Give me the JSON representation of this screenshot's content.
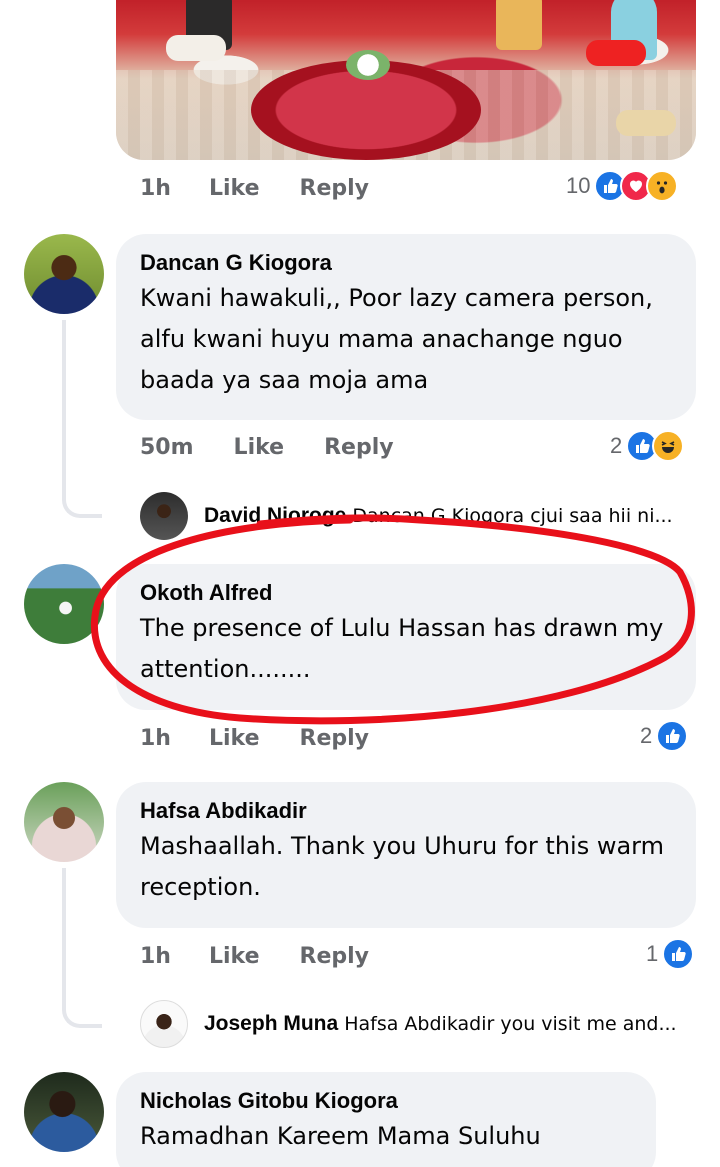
{
  "post_image": {
    "description_icon": "photo-icon"
  },
  "post_actions": {
    "time": "1h",
    "like": "Like",
    "reply": "Reply",
    "reaction_count": "10"
  },
  "comments": [
    {
      "author": "Dancan G Kiogora",
      "text": "Kwani hawakuli,, Poor lazy camera person, alfu kwani huyu mama anachange nguo baada ya saa moja ama",
      "time": "50m",
      "like": "Like",
      "reply": "Reply",
      "reaction_count": "2",
      "reply_preview": {
        "author": "David Njoroge",
        "text": "Dancan G Kiogora cjui saa hii ni..."
      }
    },
    {
      "author": "Okoth Alfred",
      "text": "The presence of Lulu Hassan has drawn my attention........",
      "time": "1h",
      "like": "Like",
      "reply": "Reply",
      "reaction_count": "2"
    },
    {
      "author": "Hafsa Abdikadir",
      "text": "Mashaallah. Thank you Uhuru for this warm reception.",
      "time": "1h",
      "like": "Like",
      "reply": "Reply",
      "reaction_count": "1",
      "reply_preview": {
        "author": "Joseph Muna",
        "text": "Hafsa Abdikadir you visit me and..."
      }
    },
    {
      "author": "Nicholas Gitobu Kiogora",
      "text": "Ramadhan Kareem Mama Suluhu Hassan."
    }
  ],
  "colors": {
    "like_blue": "#1b74e4",
    "love_red": "#f0284a",
    "wow_yellow": "#f7b125",
    "bubble_bg": "#f0f2f5",
    "annotation_red": "#e8101a"
  }
}
